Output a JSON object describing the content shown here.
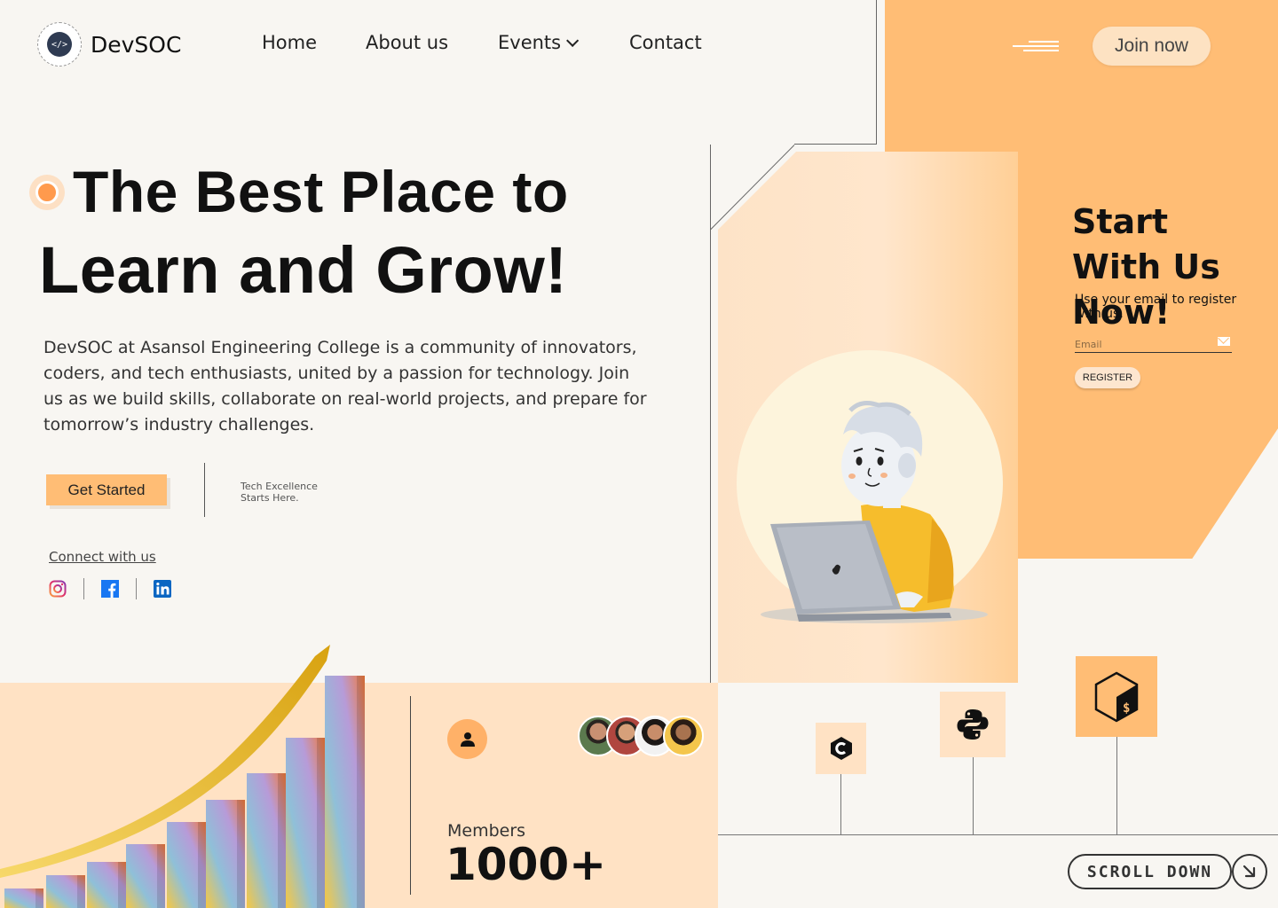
{
  "brand": {
    "name": "DevSOC"
  },
  "nav": {
    "items": [
      {
        "label": "Home"
      },
      {
        "label": "About us"
      },
      {
        "label": "Events"
      },
      {
        "label": "Contact"
      }
    ],
    "join_label": "Join now"
  },
  "hero": {
    "title_line1": "The Best Place to",
    "title_line2": "Learn and Grow!",
    "description": "DevSOC at Asansol Engineering College is a community of innovators, coders, and tech enthusiasts, united by a passion for technology. Join us as we build skills, collaborate on real-world projects, and prepare for tomorrow’s industry challenges.",
    "cta_label": "Get Started",
    "tagline": "Tech Excellence Starts Here."
  },
  "connect": {
    "label": "Connect with us",
    "socials": [
      "instagram-icon",
      "facebook-icon",
      "linkedin-icon"
    ]
  },
  "register": {
    "title": "Start With Us Now!",
    "subtitle": "Use your email to register with us.",
    "email_placeholder": "Email",
    "button_label": "REGISTER"
  },
  "members": {
    "label": "Members",
    "count": "1000+"
  },
  "tech_icons": [
    "c-lang-icon",
    "python-icon",
    "bash-terminal-icon"
  ],
  "scroll": {
    "label": "SCROLL DOWN"
  },
  "colors": {
    "accent": "#ffbd75",
    "accent_light": "#ffe2c4",
    "background": "#f8f6f2"
  }
}
